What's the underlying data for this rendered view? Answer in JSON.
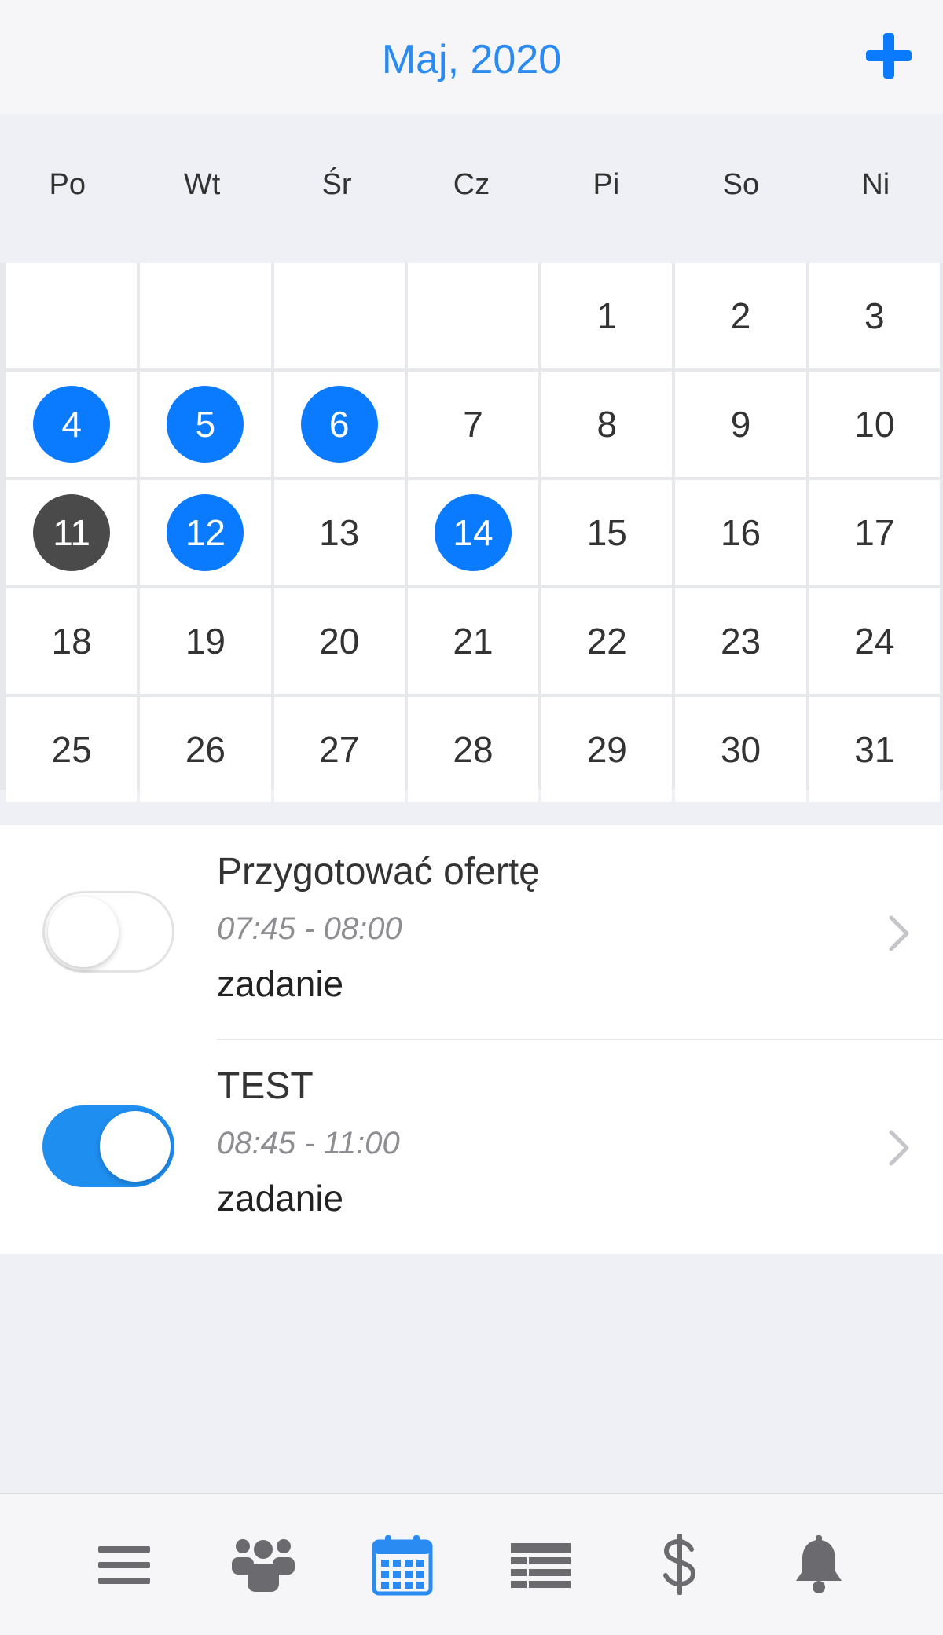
{
  "header": {
    "title": "Maj, 2020"
  },
  "weekdays": [
    "Po",
    "Wt",
    "Śr",
    "Cz",
    "Pi",
    "So",
    "Ni"
  ],
  "calendar": {
    "days": [
      {
        "n": ""
      },
      {
        "n": ""
      },
      {
        "n": ""
      },
      {
        "n": ""
      },
      {
        "n": "1"
      },
      {
        "n": "2"
      },
      {
        "n": "3"
      },
      {
        "n": "4",
        "s": "mark"
      },
      {
        "n": "5",
        "s": "mark"
      },
      {
        "n": "6",
        "s": "mark"
      },
      {
        "n": "7"
      },
      {
        "n": "8"
      },
      {
        "n": "9"
      },
      {
        "n": "10"
      },
      {
        "n": "11",
        "s": "today"
      },
      {
        "n": "12",
        "s": "mark"
      },
      {
        "n": "13"
      },
      {
        "n": "14",
        "s": "mark"
      },
      {
        "n": "15"
      },
      {
        "n": "16"
      },
      {
        "n": "17"
      },
      {
        "n": "18"
      },
      {
        "n": "19"
      },
      {
        "n": "20"
      },
      {
        "n": "21"
      },
      {
        "n": "22"
      },
      {
        "n": "23"
      },
      {
        "n": "24"
      },
      {
        "n": "25"
      },
      {
        "n": "26"
      },
      {
        "n": "27"
      },
      {
        "n": "28"
      },
      {
        "n": "29"
      },
      {
        "n": "30"
      },
      {
        "n": "31"
      }
    ]
  },
  "events": [
    {
      "title": "Przygotować ofertę",
      "time": "07:45 - 08:00",
      "type": "zadanie",
      "enabled": false
    },
    {
      "title": "TEST",
      "time": "08:45 - 11:00",
      "type": "zadanie",
      "enabled": true
    }
  ],
  "tabbar": {
    "items": [
      {
        "icon": "menu-icon",
        "active": false
      },
      {
        "icon": "contacts-icon",
        "active": false
      },
      {
        "icon": "calendar-icon",
        "active": true
      },
      {
        "icon": "list-icon",
        "active": false
      },
      {
        "icon": "dollar-icon",
        "active": false
      },
      {
        "icon": "bell-icon",
        "active": false
      }
    ]
  },
  "colors": {
    "accent": "#0a7aff",
    "today": "#4a4a4a",
    "toggle_on": "#1f8ef1",
    "tab_inactive": "#6b6b6f",
    "tab_active": "#2a8bf2"
  }
}
